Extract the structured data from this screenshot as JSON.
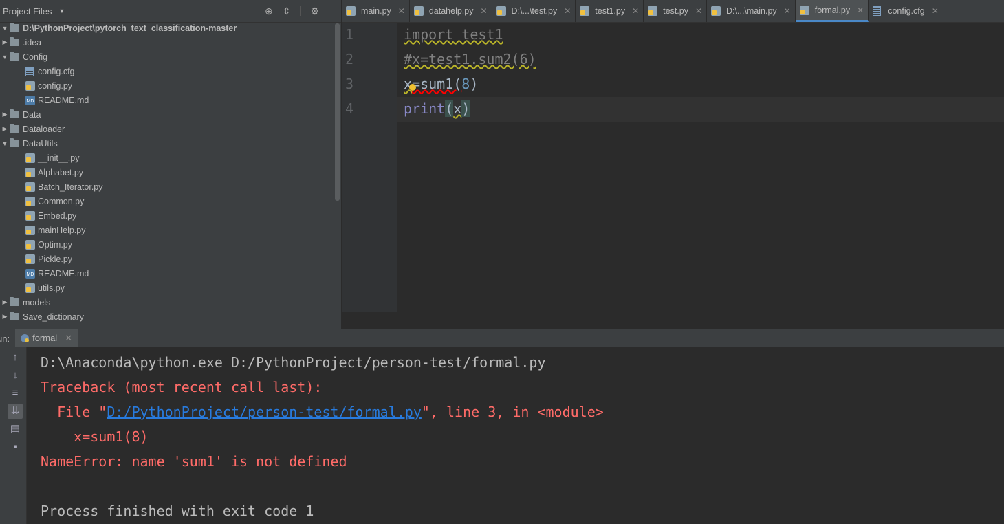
{
  "project": {
    "title": "Project Files",
    "root": "D:\\PythonProject\\pytorch_text_classification-master",
    "items": [
      {
        "label": ".idea",
        "kind": "folder",
        "expanded": false,
        "depth": 1
      },
      {
        "label": "Config",
        "kind": "folder",
        "expanded": true,
        "depth": 1
      },
      {
        "label": "config.cfg",
        "kind": "cfg",
        "depth": 2
      },
      {
        "label": "config.py",
        "kind": "py",
        "depth": 2
      },
      {
        "label": "README.md",
        "kind": "md",
        "depth": 2
      },
      {
        "label": "Data",
        "kind": "folder",
        "expanded": false,
        "depth": 1
      },
      {
        "label": "Dataloader",
        "kind": "folder",
        "expanded": false,
        "depth": 1
      },
      {
        "label": "DataUtils",
        "kind": "folder",
        "expanded": true,
        "depth": 1
      },
      {
        "label": "__init__.py",
        "kind": "py",
        "depth": 2
      },
      {
        "label": "Alphabet.py",
        "kind": "py",
        "depth": 2
      },
      {
        "label": "Batch_Iterator.py",
        "kind": "py",
        "depth": 2
      },
      {
        "label": "Common.py",
        "kind": "py",
        "depth": 2
      },
      {
        "label": "Embed.py",
        "kind": "py",
        "depth": 2
      },
      {
        "label": "mainHelp.py",
        "kind": "py",
        "depth": 2
      },
      {
        "label": "Optim.py",
        "kind": "py",
        "depth": 2
      },
      {
        "label": "Pickle.py",
        "kind": "py",
        "depth": 2
      },
      {
        "label": "README.md",
        "kind": "md",
        "depth": 2
      },
      {
        "label": "utils.py",
        "kind": "py",
        "depth": 2
      },
      {
        "label": "models",
        "kind": "folder",
        "expanded": false,
        "depth": 1
      },
      {
        "label": "Save_dictionary",
        "kind": "folder",
        "expanded": false,
        "depth": 1
      }
    ]
  },
  "tabs": [
    {
      "label": "main.py",
      "icon": "python-file-icon",
      "active": false
    },
    {
      "label": "datahelp.py",
      "icon": "python-file-icon",
      "active": false
    },
    {
      "label": "D:\\...\\test.py",
      "icon": "python-file-icon",
      "active": false
    },
    {
      "label": "test1.py",
      "icon": "python-file-icon",
      "active": false
    },
    {
      "label": "test.py",
      "icon": "python-file-icon",
      "active": false
    },
    {
      "label": "D:\\...\\main.py",
      "icon": "python-file-icon",
      "active": false
    },
    {
      "label": "formal.py",
      "icon": "python-file-icon",
      "active": true
    },
    {
      "label": "config.cfg",
      "icon": "config-file-icon",
      "active": false
    }
  ],
  "editor": {
    "line_numbers": [
      "1",
      "2",
      "3",
      "4"
    ],
    "line1": {
      "kw": "import",
      "rest": " test1"
    },
    "line2": {
      "comment": "#x=test1.sum2(6)"
    },
    "line3": {
      "a": "x",
      "b": "=sum1(",
      "num": "8",
      "c": ")"
    },
    "line4": {
      "kw": "print",
      "open": "(",
      "arg": "x",
      "close": ")"
    }
  },
  "run": {
    "label": "un:",
    "tab": "formal",
    "command": "D:\\Anaconda\\python.exe D:/PythonProject/person-test/formal.py",
    "traceback": "Traceback (most recent call last):",
    "file_prefix": "  File \"",
    "file_link": "D:/PythonProject/person-test/formal.py",
    "file_suffix": "\", line 3, in <module>",
    "code_line": "    x=sum1(8)",
    "error": "NameError: name 'sum1' is not defined",
    "blank": "",
    "finished": "Process finished with exit code 1"
  },
  "colors": {
    "accent": "#4a88c7",
    "error_text": "#ff6b68",
    "link": "#287bde",
    "keyword": "#8888c6",
    "number": "#6897bb"
  }
}
